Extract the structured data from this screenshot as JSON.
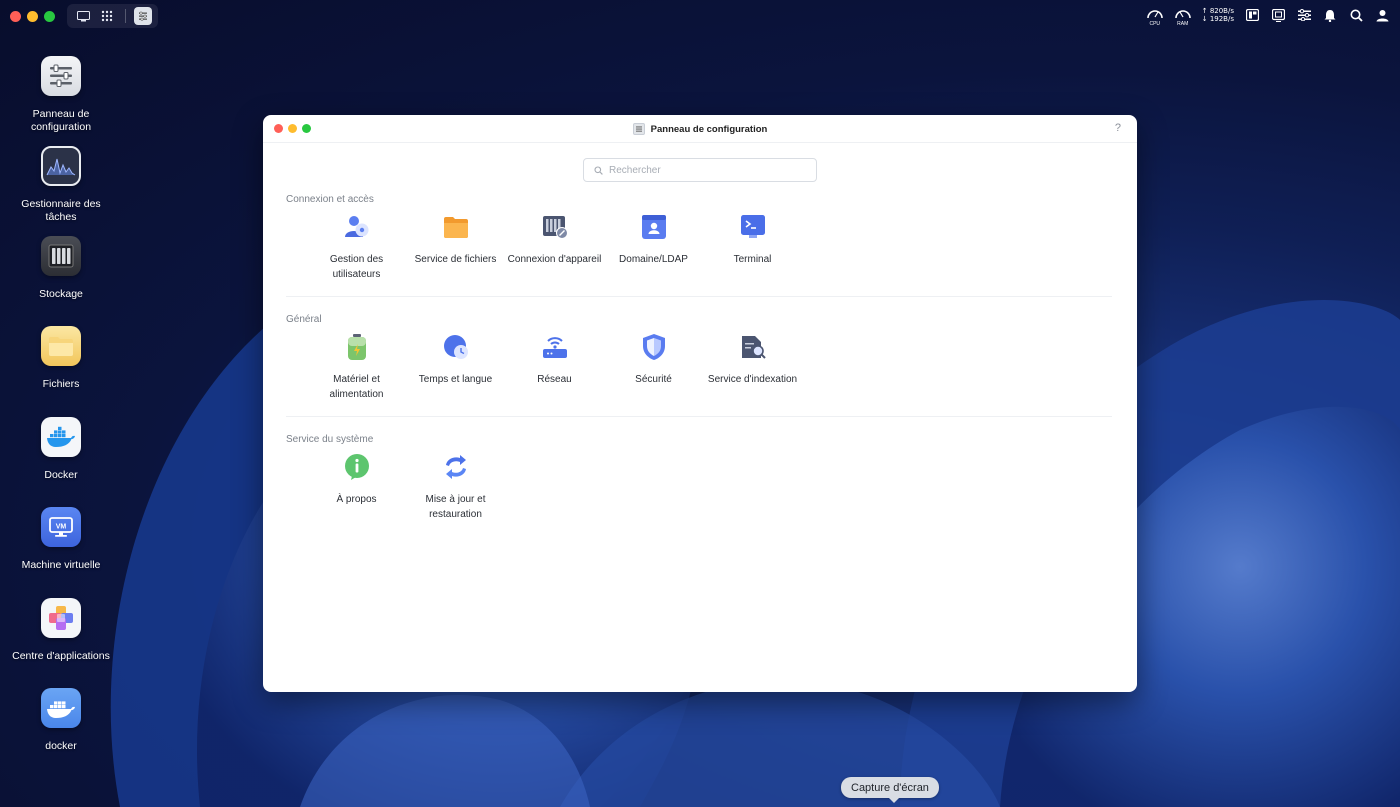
{
  "topbar": {
    "net_up": "↑ 820B/s",
    "net_down": "↓ 192B/s",
    "cpu_label": "CPU",
    "ram_label": "RAM",
    "icons": [
      "cpu-gauge-icon",
      "ram-gauge-icon",
      "widgets-icon",
      "resource-monitor-icon",
      "control-panel-icon",
      "notification-bell-icon",
      "search-icon",
      "user-icon"
    ]
  },
  "desktop": {
    "items": [
      {
        "label": "Panneau de configuration",
        "icon": "control-panel-icon"
      },
      {
        "label": "Gestionnaire des tâches",
        "icon": "task-manager-icon"
      },
      {
        "label": "Stockage",
        "icon": "storage-icon"
      },
      {
        "label": "Fichiers",
        "icon": "folder-icon"
      },
      {
        "label": "Docker",
        "icon": "docker-icon"
      },
      {
        "label": "Machine virtuelle",
        "icon": "vm-icon"
      },
      {
        "label": "Centre d'applications",
        "icon": "app-center-icon"
      },
      {
        "label": "docker",
        "icon": "docker-folder-icon"
      }
    ]
  },
  "window": {
    "title": "Panneau de configuration",
    "help": "?",
    "search_placeholder": "Rechercher",
    "sections": [
      {
        "title": "Connexion et accès",
        "items": [
          {
            "label": "Gestion des utilisateurs",
            "icon": "users-icon"
          },
          {
            "label": "Service de fichiers",
            "icon": "file-service-icon"
          },
          {
            "label": "Connexion d'appareil",
            "icon": "device-connection-icon"
          },
          {
            "label": "Domaine/LDAP",
            "icon": "domain-ldap-icon"
          },
          {
            "label": "Terminal",
            "icon": "terminal-icon"
          }
        ]
      },
      {
        "title": "Général",
        "items": [
          {
            "label": "Matériel et alimentation",
            "icon": "hardware-power-icon"
          },
          {
            "label": "Temps et langue",
            "icon": "time-language-icon"
          },
          {
            "label": "Réseau",
            "icon": "network-icon"
          },
          {
            "label": "Sécurité",
            "icon": "security-shield-icon"
          },
          {
            "label": "Service d'indexation",
            "icon": "indexing-service-icon"
          }
        ]
      },
      {
        "title": "Service du système",
        "items": [
          {
            "label": "À propos",
            "icon": "info-icon"
          },
          {
            "label": "Mise à jour et restauration",
            "icon": "update-restore-icon"
          }
        ]
      }
    ]
  },
  "tooltip": "Capture d'écran",
  "colors": {
    "accent": "#4a6cf0",
    "folder": "#f5a43a",
    "info": "#5dc56e"
  }
}
